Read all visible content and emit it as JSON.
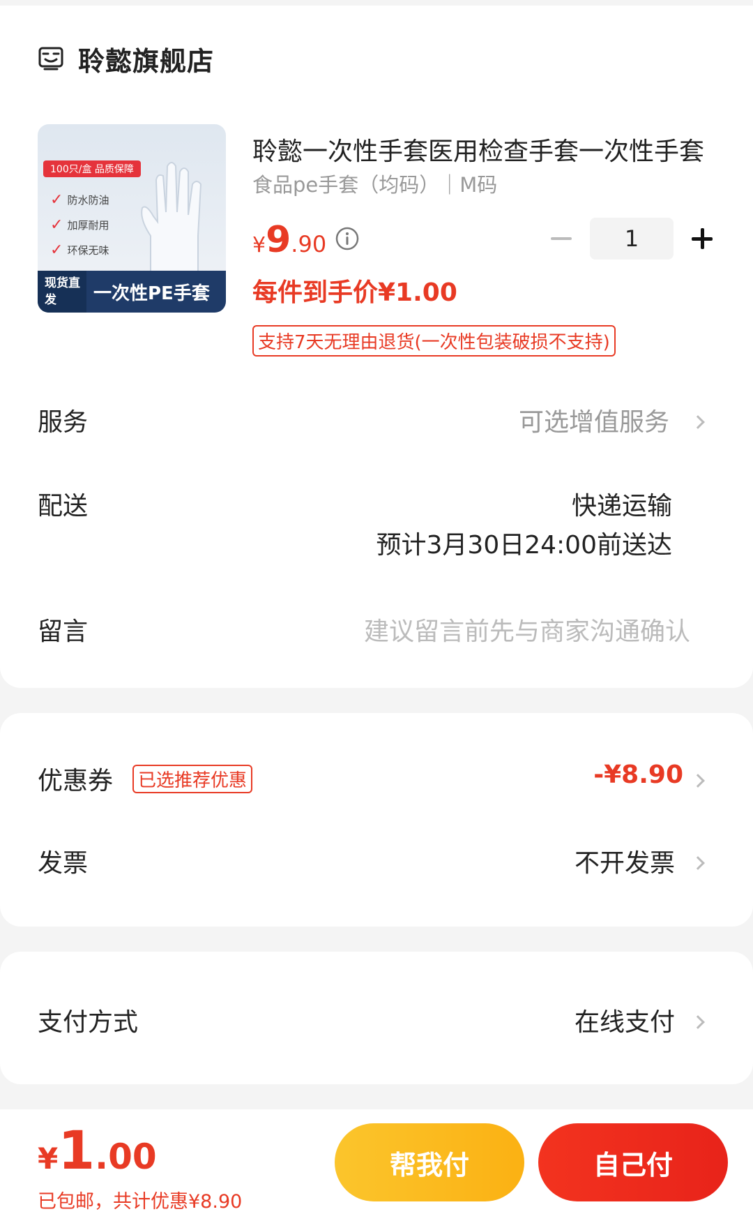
{
  "store": {
    "name": "聆懿旗舰店"
  },
  "product": {
    "title": "聆懿一次性手套医用检查手套一次性手套",
    "spec": "食品pe手套（均码）｜M码",
    "price_symbol": "¥",
    "price_int": "9",
    "price_dec": ".90",
    "quantity": "1",
    "unit_price": "每件到手价¥1.00",
    "return_policy": "支持7天无理由退货(一次性包装破损不支持)",
    "image": {
      "badge": "100只/盒 品质保障",
      "features": [
        "防水防油",
        "加厚耐用",
        "环保无味"
      ],
      "stock_label": "现货直发",
      "banner": "一次性PE手套"
    }
  },
  "rows": {
    "service": {
      "label": "服务",
      "value": "可选增值服务"
    },
    "delivery": {
      "label": "配送",
      "method": "快递运输",
      "eta": "预计3月30日24:00前送达"
    },
    "message": {
      "label": "留言",
      "placeholder": "建议留言前先与商家沟通确认"
    },
    "coupon": {
      "label": "优惠券",
      "badge": "已选推荐优惠",
      "value": "-¥8.90"
    },
    "invoice": {
      "label": "发票",
      "value": "不开发票"
    },
    "payment": {
      "label": "支付方式",
      "value": "在线支付"
    }
  },
  "footer": {
    "total_symbol": "¥",
    "total_int": "1",
    "total_dec": ".00",
    "note": "已包邮，共计优惠¥8.90",
    "help_pay": "帮我付",
    "self_pay": "自己付"
  },
  "colors": {
    "accent": "#e83a24",
    "help_button": "#fbbd20",
    "self_button": "#ee2c1d"
  }
}
